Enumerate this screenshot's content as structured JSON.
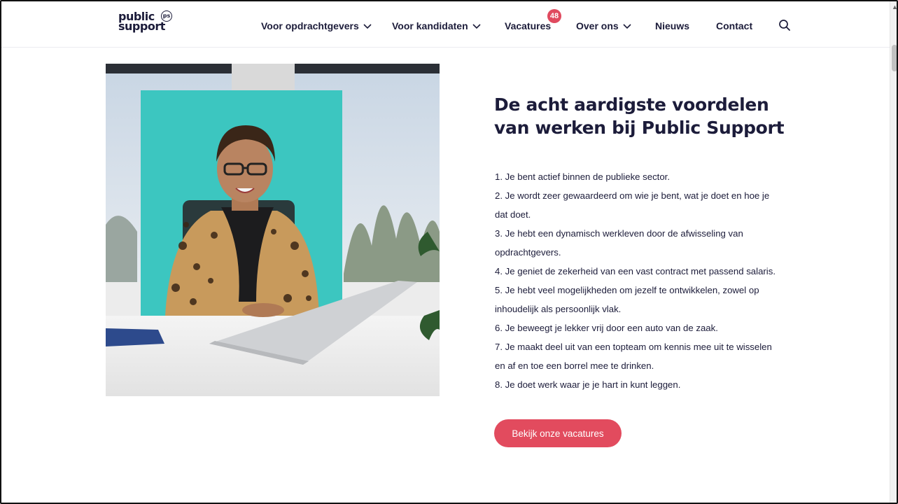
{
  "brand": {
    "line1": "public",
    "line2": "support",
    "badge": "ps"
  },
  "nav": {
    "items": [
      {
        "label": "Voor opdrachtgevers",
        "has_dropdown": true
      },
      {
        "label": "Voor kandidaten",
        "has_dropdown": true
      },
      {
        "label": "Vacatures",
        "has_dropdown": false
      },
      {
        "label": "Over ons",
        "has_dropdown": true
      },
      {
        "label": "Nieuws",
        "has_dropdown": false
      },
      {
        "label": "Contact",
        "has_dropdown": false
      }
    ],
    "vacatures_count": "48",
    "search_icon": "search-icon",
    "dropdown_icon": "chevron-down-icon"
  },
  "main": {
    "title_line1": "De acht aardigste voordelen",
    "title_line2": "van werken bij Public Support",
    "benefits": [
      "1. Je bent actief binnen de publieke sector.",
      "2. Je wordt zeer gewaardeerd om wie je bent, wat je doet en hoe je dat doet.",
      "3. Je hebt een dynamisch werkleven door de afwisseling van opdrachtgevers.",
      "4. Je geniet de zekerheid van een vast contract met passend salaris.",
      "5. Je hebt veel mogelijkheden om jezelf te ontwikkelen, zowel op inhoudelijk als persoonlijk vlak.",
      "6. Je beweegt je lekker vrij door een auto van de zaak.",
      "7. Je maakt deel uit van een topteam om kennis mee uit te wisselen en af en toe een borrel mee te drinken.",
      "8. Je doet werk waar je je hart in kunt leggen."
    ],
    "cta_label": "Bekijk onze vacatures"
  },
  "colors": {
    "accent": "#e24b5e",
    "text": "#1c1c3a",
    "photo_teal": "#3cc6c0"
  }
}
